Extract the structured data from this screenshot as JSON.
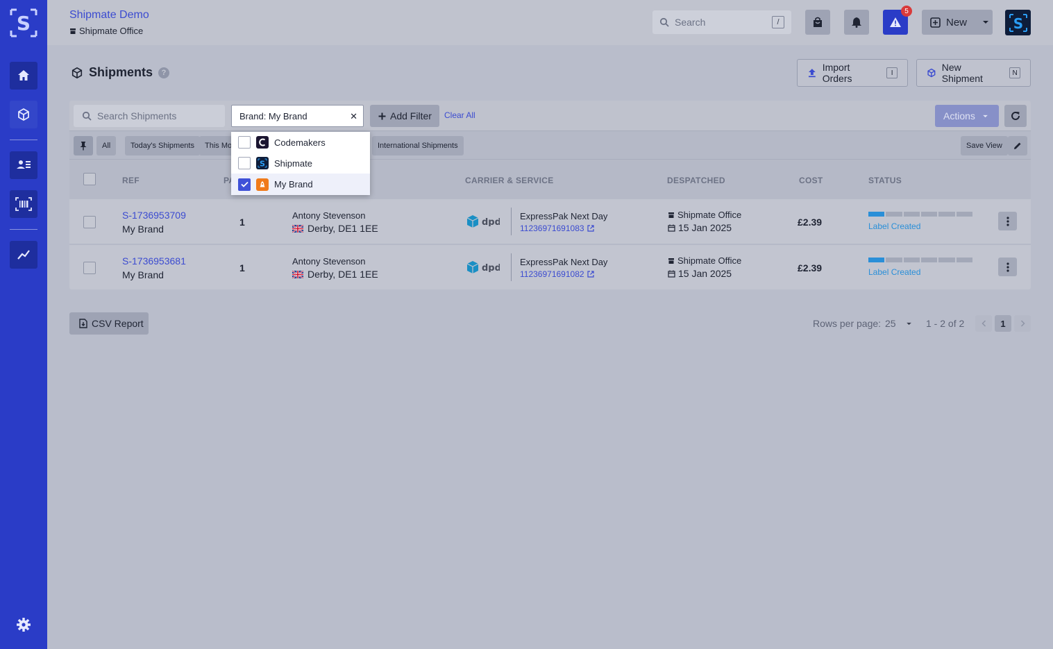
{
  "header": {
    "account": "Shipmate Demo",
    "location": "Shipmate Office",
    "search_placeholder": "Search",
    "search_shortcut": "/",
    "alert_count": "5",
    "new_label": "New"
  },
  "page": {
    "title": "Shipments",
    "help": "?",
    "import_label": "Import Orders",
    "import_key": "I",
    "new_shipment_label": "New Shipment",
    "new_shipment_key": "N"
  },
  "toolbar": {
    "search_placeholder": "Search Shipments",
    "filter_value": "Brand: My Brand",
    "add_filter": "Add Filter",
    "clear_all": "Clear All",
    "actions": "Actions"
  },
  "brand_options": [
    {
      "label": "Codemakers",
      "checked": false
    },
    {
      "label": "Shipmate",
      "checked": false
    },
    {
      "label": "My Brand",
      "checked": true
    }
  ],
  "views": [
    "All",
    "Today's Shipments",
    "This Mo",
    "International Shipments"
  ],
  "save_view": "Save View",
  "columns": {
    "ref": "REF",
    "packages": "PA",
    "carrier": "CARRIER & SERVICE",
    "despatched": "DESPATCHED",
    "cost": "COST",
    "status": "STATUS"
  },
  "rows": [
    {
      "ref": "S-1736953709",
      "brand": "My Brand",
      "packages": "1",
      "customer": "Antony Stevenson",
      "address": "Derby, DE1 1EE",
      "service": "ExpressPak Next Day",
      "tracking": "11236971691083",
      "location": "Shipmate Office",
      "date": "15 Jan 2025",
      "cost": "£2.39",
      "status": "Label Created",
      "progress": 0.17
    },
    {
      "ref": "S-1736953681",
      "brand": "My Brand",
      "packages": "1",
      "customer": "Antony Stevenson",
      "address": "Derby, DE1 1EE",
      "service": "ExpressPak Next Day",
      "tracking": "11236971691082",
      "location": "Shipmate Office",
      "date": "15 Jan 2025",
      "cost": "£2.39",
      "status": "Label Created",
      "progress": 0.17
    }
  ],
  "footer": {
    "csv": "CSV Report",
    "rows_label": "Rows per page:",
    "rows_value": "25",
    "range": "1 - 2 of 2",
    "page": "1"
  },
  "colors": {
    "brand": "#2a3cc7",
    "link": "#3b4bd0",
    "status": "#2a8fd8"
  }
}
